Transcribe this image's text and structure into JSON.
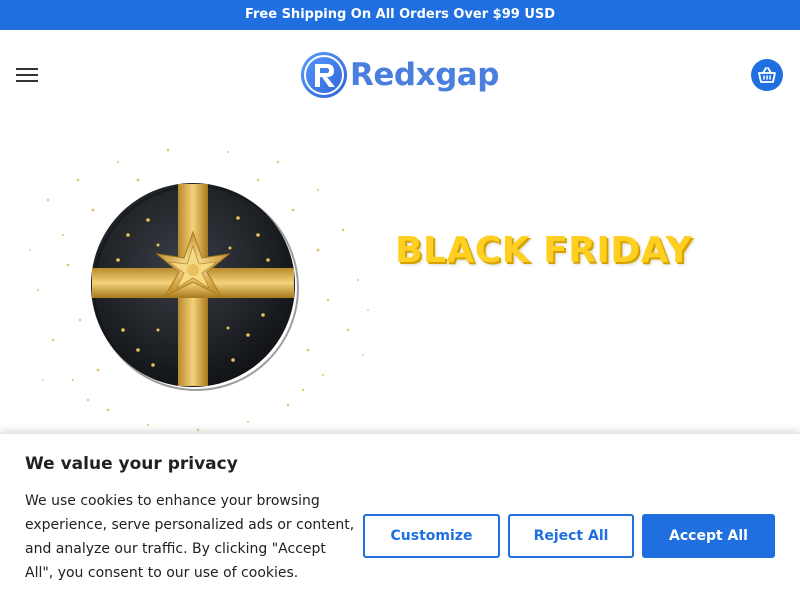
{
  "announcement": {
    "text": "Free Shipping On All Orders Over $99 USD"
  },
  "header": {
    "logo_text": "Redxgap",
    "menu_icon": "hamburger-menu-icon",
    "cart_icon": "shopping-basket-icon"
  },
  "hero": {
    "title": "BLACK FRIDAY",
    "image": "gift-box-icon"
  },
  "cookie_banner": {
    "title": "We value your privacy",
    "text": "We use cookies to enhance your browsing experience, serve personalized ads or content, and analyze our traffic. By clicking \"Accept All\", you consent to our use of cookies.",
    "customize_label": "Customize",
    "reject_label": "Reject All",
    "accept_label": "Accept All"
  },
  "colors": {
    "brand_blue": "#1f6fe0",
    "gold": "#ffcf22"
  }
}
